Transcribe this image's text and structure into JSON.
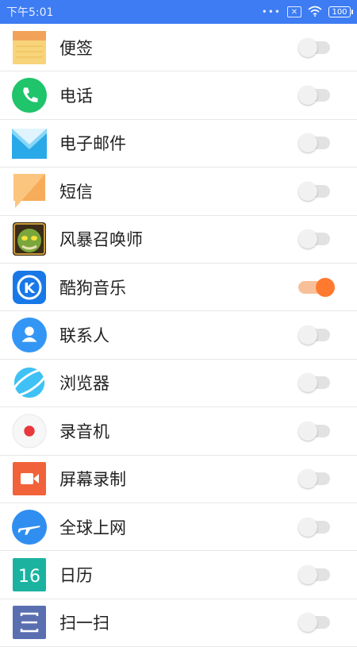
{
  "status_bar": {
    "time": "下午5:01",
    "dots": "•••",
    "sim": "✕",
    "battery": "100"
  },
  "apps": [
    {
      "label": "便签",
      "icon": "notes-icon",
      "enabled": false
    },
    {
      "label": "电话",
      "icon": "phone-icon",
      "enabled": false
    },
    {
      "label": "电子邮件",
      "icon": "email-icon",
      "enabled": false
    },
    {
      "label": "短信",
      "icon": "sms-icon",
      "enabled": false
    },
    {
      "label": "风暴召唤师",
      "icon": "game-icon",
      "enabled": false
    },
    {
      "label": "酷狗音乐",
      "icon": "kugou-music-icon",
      "enabled": true
    },
    {
      "label": "联系人",
      "icon": "contacts-icon",
      "enabled": false
    },
    {
      "label": "浏览器",
      "icon": "browser-icon",
      "enabled": false
    },
    {
      "label": "录音机",
      "icon": "recorder-icon",
      "enabled": false
    },
    {
      "label": "屏幕录制",
      "icon": "screen-recorder-icon",
      "enabled": false
    },
    {
      "label": "全球上网",
      "icon": "global-internet-icon",
      "enabled": false
    },
    {
      "label": "日历",
      "icon": "calendar-icon",
      "enabled": false,
      "icon_text": "16"
    },
    {
      "label": "扫一扫",
      "icon": "scanner-icon",
      "enabled": false
    }
  ],
  "colors": {
    "status_bar": "#3d7cf3",
    "toggle_on": "#ff7a2f",
    "toggle_on_track": "#f8c09a",
    "toggle_off_track": "#e2e2e2"
  }
}
